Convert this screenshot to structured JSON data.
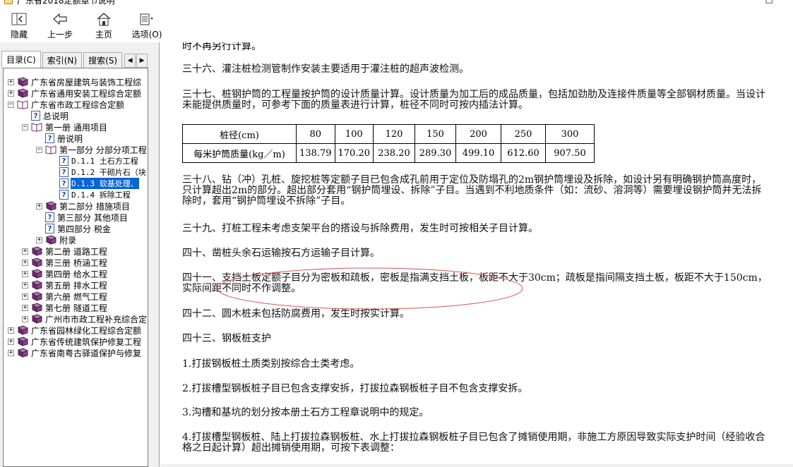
{
  "window": {
    "title": "广东省2018定额章节说明",
    "buttons": [
      "—",
      "□"
    ]
  },
  "toolbar": {
    "buttons": [
      {
        "label": "隐藏",
        "icon": "hide-icon"
      },
      {
        "label": "上一步",
        "icon": "back-arrow-icon"
      },
      {
        "label": "主页",
        "icon": "home-icon"
      },
      {
        "label": "选项(O)",
        "icon": "options-icon"
      }
    ]
  },
  "tabs": [
    {
      "label": "目录(C)",
      "active": true
    },
    {
      "label": "索引(N)",
      "active": false
    },
    {
      "label": "搜索(S)",
      "active": false
    }
  ],
  "tab_scroll": {
    "left": "◀",
    "right": "▶"
  },
  "tree": [
    {
      "label": "广东省房屋建筑与装饰工程综",
      "level": 0,
      "type": "book",
      "expander": "+"
    },
    {
      "label": "广东省通用安装工程综合定额",
      "level": 0,
      "type": "book",
      "expander": "+"
    },
    {
      "label": "广东省市政工程综合定额",
      "level": 0,
      "type": "openbook",
      "expander": "−"
    },
    {
      "label": "总说明",
      "level": 1,
      "type": "page",
      "expander": ""
    },
    {
      "label": "第一册 通用项目",
      "level": 1,
      "type": "openbook",
      "expander": "−"
    },
    {
      "label": "册说明",
      "level": 2,
      "type": "page",
      "expander": ""
    },
    {
      "label": "第一部分 分部分项工程",
      "level": 2,
      "type": "openbook",
      "expander": "−"
    },
    {
      "label": "D.1.1 土石方工程",
      "level": 3,
      "type": "page",
      "expander": ""
    },
    {
      "label": "D.1.2 干砌片石（块",
      "level": 3,
      "type": "page",
      "expander": ""
    },
    {
      "label": "D.1.3 软基处理、",
      "level": 3,
      "type": "page",
      "expander": "",
      "selected": true
    },
    {
      "label": "D.1.4 拆除工程",
      "level": 3,
      "type": "page",
      "expander": ""
    },
    {
      "label": "第二部分 措施项目",
      "level": 2,
      "type": "book",
      "expander": "+"
    },
    {
      "label": "第三部分 其他项目",
      "level": 2,
      "type": "page",
      "expander": ""
    },
    {
      "label": "第四部分 税金",
      "level": 2,
      "type": "page",
      "expander": ""
    },
    {
      "label": "附录",
      "level": 2,
      "type": "book",
      "expander": "+"
    },
    {
      "label": "第二册 道路工程",
      "level": 1,
      "type": "book",
      "expander": "+"
    },
    {
      "label": "第三册 桥涵工程",
      "level": 1,
      "type": "book",
      "expander": "+"
    },
    {
      "label": "第四册 给水工程",
      "level": 1,
      "type": "book",
      "expander": "+"
    },
    {
      "label": "第五册 排水工程",
      "level": 1,
      "type": "book",
      "expander": "+"
    },
    {
      "label": "第六册 燃气工程",
      "level": 1,
      "type": "book",
      "expander": "+"
    },
    {
      "label": "第七册 隧道工程",
      "level": 1,
      "type": "book",
      "expander": "+"
    },
    {
      "label": "广州市市政工程补充综合定",
      "level": 1,
      "type": "book",
      "expander": "+"
    },
    {
      "label": "广东省园林绿化工程综合定额",
      "level": 0,
      "type": "book",
      "expander": "+"
    },
    {
      "label": "广东省传统建筑保护修复工程",
      "level": 0,
      "type": "book",
      "expander": "+"
    },
    {
      "label": "广东省南粤古驿道保护与修复",
      "level": 0,
      "type": "book",
      "expander": "+"
    }
  ],
  "content": {
    "cut_line": "时不再另行计算。",
    "paragraphs": [
      "三十六、灌注桩检测管制作安装主要适用于灌注桩的超声波检测。",
      "三十七、桩钢护筒的工程量按护筒的设计质量计算。设计质量为加工后的成品质量，包括加劲肋及连接件质量等全部钢材质量。当设计未能提供质量时，可参考下面的质量表进行计算，桩径不同时可按内插法计算。",
      "三十八、钻（冲）孔桩、旋挖桩等定额子目已包含成孔前用于定位及防塌孔的2m钢护筒埋设及拆除，如设计另有明确钢护筒高度时，只计算超出2m的部分。超出部分套用“钢护筒埋设、拆除”子目。当遇到不利地质条件（如：流砂、溶洞等）需要埋设钢护筒并无法拆除时，套用“钢护筒埋设不拆除”子目。",
      "三十九、打桩工程未考虑支架平台的搭设与拆除费用，发生时可按相关子目计算。",
      "四十、凿桩头余石运输按石方运输子目计算。",
      "四十一、支挡土板定额子目分为密板和疏板，密板是指满支挡土板，板距不大于30cm；疏板是指间隔支挡土板，板距不大于150cm，实际间距不同时不作调整。",
      "四十二、圆木桩未包括防腐费用，发生时按实计算。",
      "四十三、钢板桩支护",
      "1.打拔钢板桩土质类别按综合土类考虑。",
      "2.打拔槽型钢板桩子目已包含支撑安拆，打拔拉森钢板桩子目不包含支撑安拆。",
      "3.沟槽和基坑的划分按本册土石方工程章说明中的规定。",
      "4.打拔槽型钢板桩、陆上打拔拉森钢板桩、水上打拔拉森钢板桩子目已包含了摊销使用期，非施工方原因导致实际支护时间（经验收合格之日起计算）超出摊销使用期，可按下表调整："
    ],
    "table": {
      "row_headers": [
        "桩径(cm)",
        "每米护筒质量(kg／m)"
      ],
      "diameters": [
        "80",
        "100",
        "120",
        "150",
        "200",
        "250",
        "300"
      ],
      "masses": [
        "138.79",
        "170.20",
        "238.20",
        "289.30",
        "499.10",
        "612.60",
        "907.50"
      ]
    }
  },
  "colors": {
    "selection": "#0a64d6",
    "annotation_ellipse": "#d9534f"
  }
}
